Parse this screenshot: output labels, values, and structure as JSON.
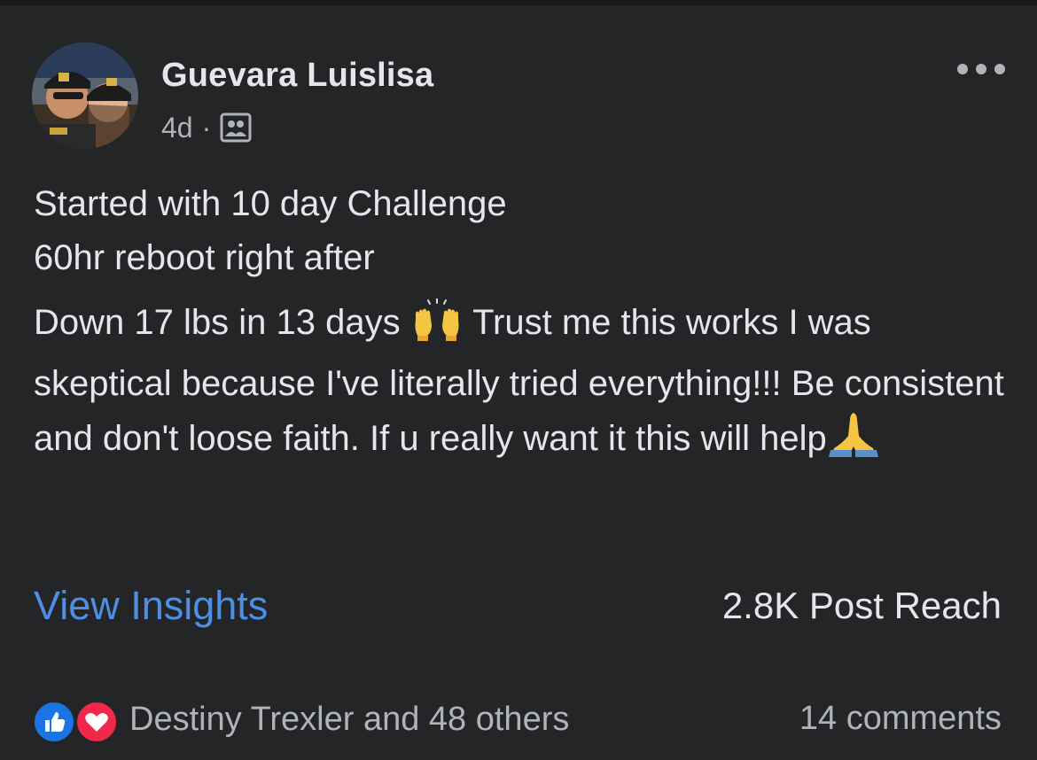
{
  "post": {
    "author": "Guevara Luislisa",
    "time": "4d",
    "separator": "·",
    "audience_icon": "group-audience-icon",
    "lines": {
      "line1": "Started with 10 day Challenge",
      "line2": "60hr reboot right after",
      "para2_part1": "Down 17 lbs in 13 days",
      "para2_part2": " Trust me this works I was skeptical because I've literally tried everything!!! Be consistent and don't loose faith. If u really want it this will help"
    },
    "emojis": [
      "raising-hands-emoji",
      "folded-hands-emoji"
    ]
  },
  "insights": {
    "link_label": "View Insights",
    "reach": "2.8K Post Reach"
  },
  "footer": {
    "reactors": "Destiny Trexler and 48 others",
    "comments": "14 comments",
    "reaction_icons": [
      "like-icon",
      "love-icon"
    ]
  },
  "colors": {
    "background": "#242526",
    "text_primary": "#e4e6eb",
    "text_secondary": "#b0b3b8",
    "link": "#4e8fe6",
    "like_blue": "#1b74e4",
    "love_red": "#f02849"
  }
}
